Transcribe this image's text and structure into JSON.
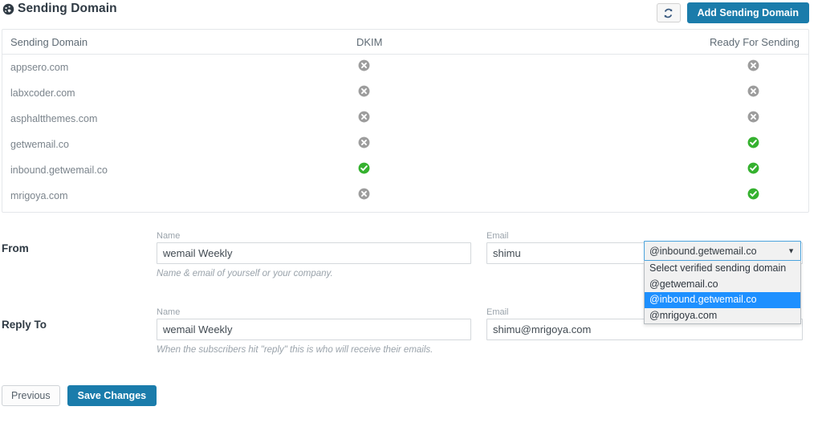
{
  "header": {
    "title": "Sending Domain",
    "globe_icon": "globe-icon",
    "refresh_icon": "refresh-icon",
    "add_domain_label": "Add Sending Domain"
  },
  "table": {
    "columns": [
      "Sending Domain",
      "DKIM",
      "Ready For Sending"
    ],
    "rows": [
      {
        "domain": "appsero.com",
        "dkim": "cross",
        "ready": "cross"
      },
      {
        "domain": "labxcoder.com",
        "dkim": "cross",
        "ready": "cross"
      },
      {
        "domain": "asphaltthemes.com",
        "dkim": "cross",
        "ready": "cross"
      },
      {
        "domain": "getwemail.co",
        "dkim": "cross",
        "ready": "check"
      },
      {
        "domain": "inbound.getwemail.co",
        "dkim": "check",
        "ready": "check"
      },
      {
        "domain": "mrigoya.com",
        "dkim": "cross",
        "ready": "check"
      }
    ]
  },
  "form": {
    "from": {
      "side_label": "From",
      "name_label": "Name",
      "name_value": "wemail Weekly",
      "email_label": "Email",
      "email_value": "shimu",
      "helper": "Name & email of yourself or your company."
    },
    "reply_to": {
      "side_label": "Reply To",
      "name_label": "Name",
      "name_value": "wemail Weekly",
      "email_label": "Email",
      "email_value": "shimu@mrigoya.com",
      "helper": "When the subscribers hit \"reply\" this is who will receive their emails."
    },
    "domain_select": {
      "selected": "@inbound.getwemail.co",
      "caret_icon": "chevron-down-icon",
      "options": [
        "Select verified sending domain",
        "@getwemail.co",
        "@inbound.getwemail.co",
        "@mrigoya.com"
      ],
      "highlighted_index": 2
    }
  },
  "footer": {
    "previous_label": "Previous",
    "save_label": "Save Changes"
  },
  "colors": {
    "accent_blue": "#1a7cab",
    "highlight_blue": "#1e90ff",
    "status_ok_green": "#35b12f",
    "status_bad_grey": "#9d9d9d"
  }
}
